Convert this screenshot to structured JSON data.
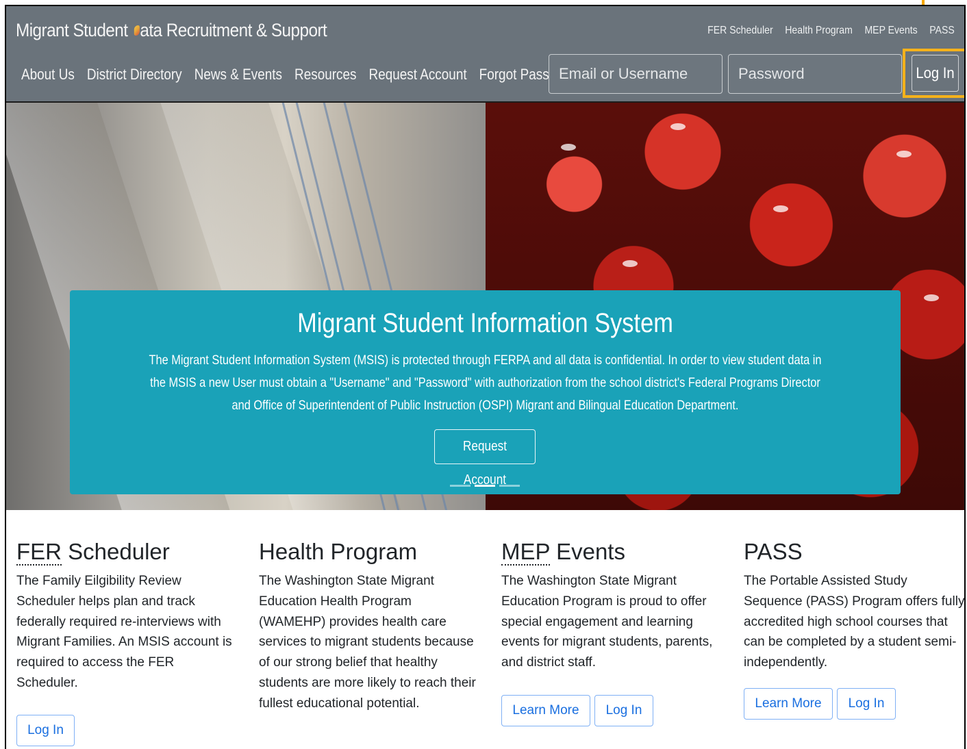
{
  "header": {
    "brand_prefix": "Migrant Student ",
    "brand_suffix": "ata Recruitment & Support",
    "top_links": [
      "FER Scheduler",
      "Health Program",
      "MEP Events",
      "PASS"
    ],
    "nav": [
      "About Us",
      "District Directory",
      "News & Events",
      "Resources",
      "Request Account",
      "Forgot Password"
    ],
    "email_placeholder": "Email or Username",
    "password_placeholder": "Password",
    "login_label": "Log In"
  },
  "hero": {
    "title": "Migrant Student Information System",
    "body": "The Migrant Student Information System (MSIS) is protected through FERPA and all data is confidential. In order to view student data in the MSIS a new User must obtain a \"Username\" and \"Password\" with authorization from the school district's Federal Programs Director and Office of Superintendent of Public Instruction (OSPI) Migrant and Bilingual Education Department.",
    "button": "Request Account",
    "slide_count": 3,
    "active_slide": 2
  },
  "cards": [
    {
      "abbr": "FER",
      "title_rest": " Scheduler",
      "text": "The Family Eilgibility Review Scheduler helps plan and track federally required re-interviews with Migrant Families. An MSIS account is required to access the FER Scheduler.",
      "buttons": [
        "Log In"
      ]
    },
    {
      "abbr": "",
      "title_rest": "Health Program",
      "text": "The Washington State Migrant Education Health Program (WAMEHP) provides health care services to migrant students because of our strong belief that healthy students are more likely to reach their fullest educational potential.",
      "buttons": []
    },
    {
      "abbr": "MEP",
      "title_rest": " Events",
      "text": "The Washington State Migrant Education Program is proud to offer special engagement and learning events for migrant students, parents, and district staff.",
      "buttons": [
        "Learn More",
        "Log In"
      ]
    },
    {
      "abbr": "",
      "title_rest": "PASS",
      "text": "The Portable Assisted Study Sequence (PASS) Program offers fully accredited high school courses that can be completed by a student semi-independently.",
      "buttons": [
        "Learn More",
        "Log In"
      ]
    }
  ],
  "colors": {
    "header_bg": "#6a737b",
    "caption_bg": "#1aa2b8",
    "highlight": "#f5b21b",
    "link_blue": "#1a6fe0"
  }
}
